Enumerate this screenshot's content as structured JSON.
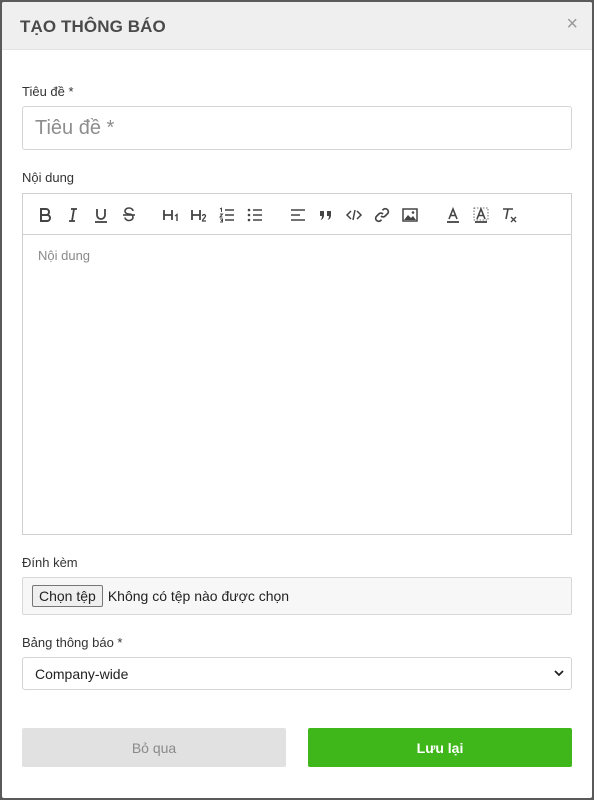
{
  "modal": {
    "title": "TẠO THÔNG BÁO",
    "close_glyph": "×"
  },
  "title_field": {
    "label": "Tiêu đề *",
    "placeholder": "Tiêu đề *",
    "value": ""
  },
  "content_field": {
    "label": "Nội dung",
    "placeholder": "Nội dung",
    "toolbar": [
      "bold-icon",
      "italic-icon",
      "underline-icon",
      "strikethrough-icon",
      "heading1-icon",
      "heading2-icon",
      "ordered-list-icon",
      "bullet-list-icon",
      "align-icon",
      "blockquote-icon",
      "code-icon",
      "link-icon",
      "image-icon",
      "text-color-icon",
      "background-color-icon",
      "clear-format-icon"
    ]
  },
  "attachment_field": {
    "label": "Đính kèm",
    "button_label": "Chọn tệp",
    "status": "Không có tệp nào được chọn"
  },
  "board_field": {
    "label": "Bảng thông báo *",
    "selected": "Company-wide"
  },
  "actions": {
    "cancel_label": "Bỏ qua",
    "save_label": "Lưu lại"
  },
  "colors": {
    "header_bg": "#efefef",
    "save_bg": "#3fb619",
    "cancel_bg": "#e1e1e1"
  }
}
